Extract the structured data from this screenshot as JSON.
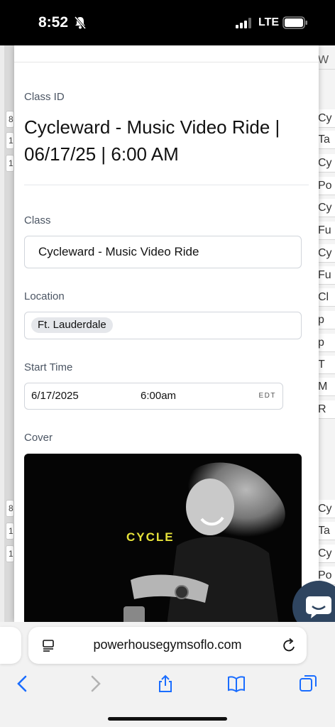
{
  "status_bar": {
    "time": "8:52",
    "network": "LTE"
  },
  "background_page": {
    "left_cells": [
      "8",
      "1",
      "1",
      "8",
      "1",
      "1"
    ],
    "right_header": "W",
    "right_cells": [
      "Cy",
      "Ta",
      "Cy",
      "Po",
      "Cy",
      "Fu",
      "Cy",
      "Fu",
      "Cl",
      "p",
      "p",
      "T",
      "M",
      "R",
      "Cy",
      "Ta",
      "Cy",
      "Po"
    ]
  },
  "modal": {
    "class_id_label": "Class ID",
    "class_id_value": "Cycleward - Music Video Ride | 06/17/25 | 6:00 AM",
    "class_label": "Class",
    "class_value": "Cycleward - Music Video Ride",
    "location_label": "Location",
    "location_chip": "Ft. Lauderdale",
    "start_time_label": "Start Time",
    "start_date": "6/17/2025",
    "start_time": "6:00am",
    "timezone": "EDT",
    "cover_label": "Cover",
    "cover_text": "CYCLE"
  },
  "browser": {
    "url": "powerhousegymsoflo.com",
    "icons": [
      "back-icon",
      "forward-icon",
      "share-icon",
      "bookmarks-icon",
      "tabs-icon",
      "reload-icon",
      "page-menu-icon"
    ]
  },
  "colors": {
    "chat_button": "#2f4560",
    "browser_accent": "#1a6dff",
    "cover_text": "#e6e23a"
  }
}
